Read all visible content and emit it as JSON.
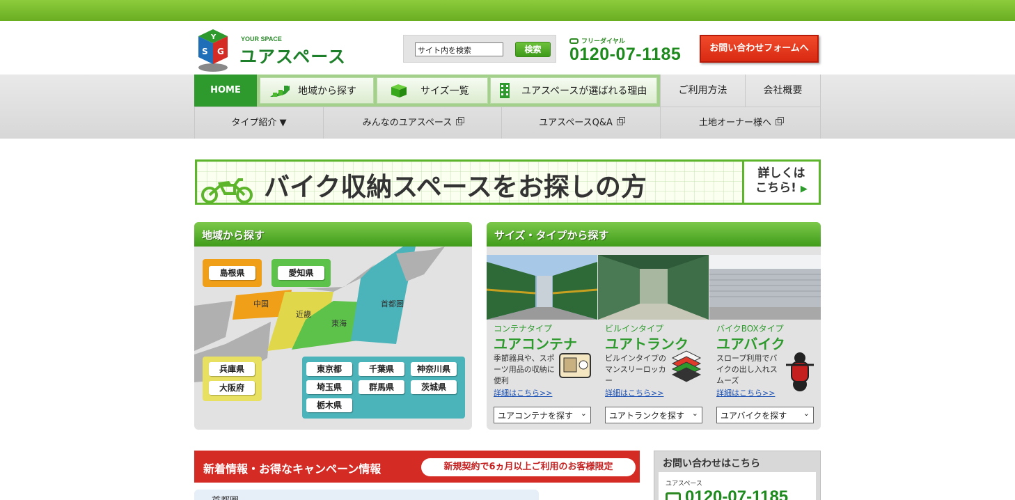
{
  "header": {
    "logo_small": "YOUR SPACE",
    "logo_big": "ユアスペース",
    "search": {
      "value": "サイト内を検索",
      "button": "検索"
    },
    "phone_label": "フリーダイヤル",
    "phone_number": "0120-07-1185",
    "contact_button": "お問い合わせフォームへ"
  },
  "nav": {
    "row1": [
      {
        "label": "HOME"
      },
      {
        "label": "地域から探す",
        "icon": "map-icon"
      },
      {
        "label": "サイズ一覧",
        "icon": "box-icon"
      },
      {
        "label": "ユアスペースが選ばれる理由",
        "icon": "building-icon"
      },
      {
        "label": "ご利用方法"
      },
      {
        "label": "会社概要"
      }
    ],
    "row2": [
      {
        "label": "タイプ紹介 ▼"
      },
      {
        "label": "みんなのユアスペース"
      },
      {
        "label": "ユアスペースQ&A"
      },
      {
        "label": "土地オーナー様へ"
      }
    ]
  },
  "banner": {
    "text": "バイク収納スペースをお探しの方",
    "more_line1": "詳しくは",
    "more_line2": "こちら!",
    "arrow": "▶"
  },
  "region_panel": {
    "title": "地域から探す",
    "region_buttons": [
      {
        "label": "島根県",
        "color": "#f0a018"
      },
      {
        "label": "愛知県",
        "color": "#5cc24a"
      }
    ],
    "map_labels": [
      "中国",
      "近畿",
      "東海",
      "首都圏"
    ],
    "kinki_prefs": [
      "兵庫県",
      "大阪府"
    ],
    "kanto_prefs": [
      "東京都",
      "千葉県",
      "神奈川県",
      "埼玉県",
      "群馬県",
      "茨城県",
      "栃木県"
    ]
  },
  "type_panel": {
    "title": "サイズ・タイプから探す",
    "types": [
      {
        "sub": "コンテナタイプ",
        "name": "ユアコンテナ",
        "desc": "季節器具や、スポーツ用品の収納に便利",
        "link": "詳細はこちら>>",
        "select": "ユアコンテナを探す",
        "illus": "radio-icon"
      },
      {
        "sub": "ビルインタイプ",
        "name": "ユアトランク",
        "desc": "ビルインタイプのマンスリーロッカー",
        "link": "詳細はこちら>>",
        "select": "ユアトランクを探す",
        "illus": "clothes-icon"
      },
      {
        "sub": "バイクBOXタイプ",
        "name": "ユアバイク",
        "desc": "スロープ利用でバイクの出し入れスムーズ",
        "link": "詳細はこちら>>",
        "select": "ユアバイクを探す",
        "illus": "motorcycle-icon"
      }
    ]
  },
  "news": {
    "title": "新着情報・お得なキャンペーン情報",
    "badge": "新規契約で6ヵ月以上ご利用のお客様限定",
    "sub": "首都圏"
  },
  "side": {
    "title": "お問い合わせはこちら",
    "label": "ユアスペース",
    "phone": "0120-07-1185"
  },
  "colors": {
    "brand_green": "#2e9a2e",
    "accent_red": "#d52b25",
    "topbar": "#7cbf32"
  }
}
